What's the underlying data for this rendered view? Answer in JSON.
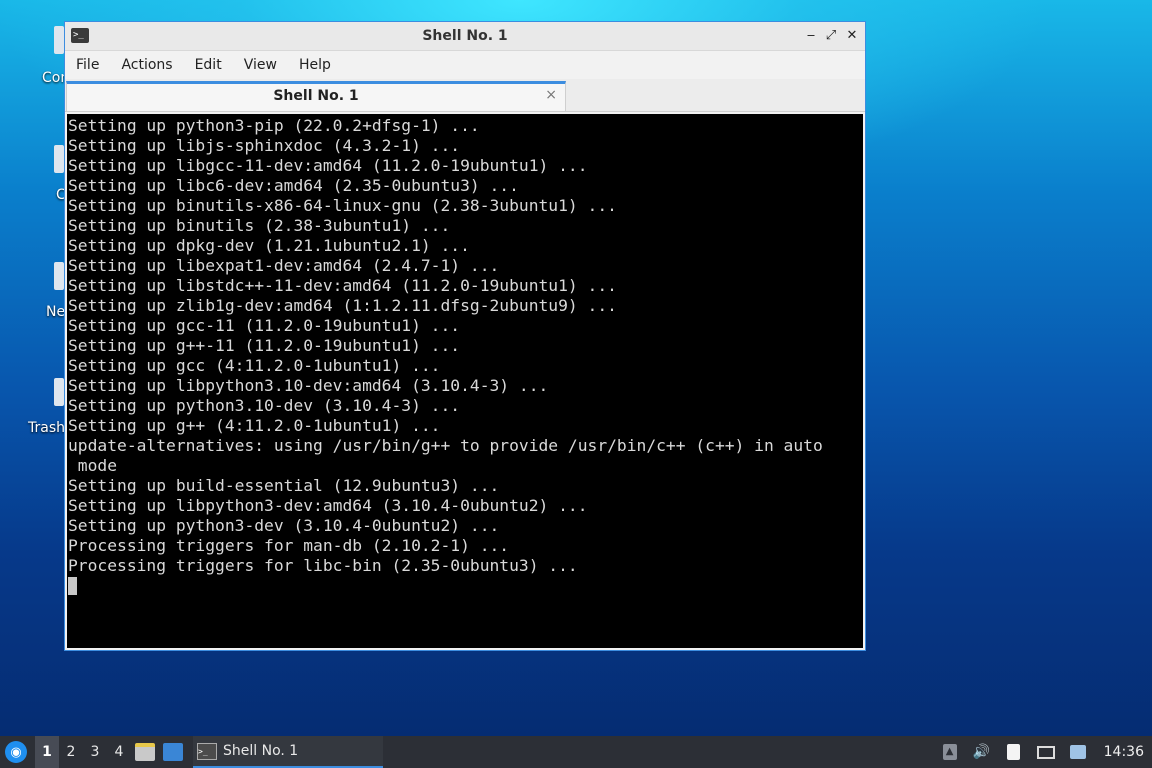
{
  "desktop": {
    "icons": [
      {
        "label": "Com"
      },
      {
        "label": "C"
      },
      {
        "label": "Ne"
      },
      {
        "label": "Trash"
      }
    ]
  },
  "window": {
    "title": "Shell No. 1",
    "controls": {
      "minimize": "‒",
      "maximize": "⤢",
      "close": "✕"
    },
    "menu": [
      "File",
      "Actions",
      "Edit",
      "View",
      "Help"
    ],
    "tab": {
      "label": "Shell No. 1",
      "close": "×"
    }
  },
  "terminal": {
    "lines": [
      "Setting up python3-pip (22.0.2+dfsg-1) ...",
      "Setting up libjs-sphinxdoc (4.3.2-1) ...",
      "Setting up libgcc-11-dev:amd64 (11.2.0-19ubuntu1) ...",
      "Setting up libc6-dev:amd64 (2.35-0ubuntu3) ...",
      "Setting up binutils-x86-64-linux-gnu (2.38-3ubuntu1) ...",
      "Setting up binutils (2.38-3ubuntu1) ...",
      "Setting up dpkg-dev (1.21.1ubuntu2.1) ...",
      "Setting up libexpat1-dev:amd64 (2.4.7-1) ...",
      "Setting up libstdc++-11-dev:amd64 (11.2.0-19ubuntu1) ...",
      "Setting up zlib1g-dev:amd64 (1:1.2.11.dfsg-2ubuntu9) ...",
      "Setting up gcc-11 (11.2.0-19ubuntu1) ...",
      "Setting up g++-11 (11.2.0-19ubuntu1) ...",
      "Setting up gcc (4:11.2.0-1ubuntu1) ...",
      "Setting up libpython3.10-dev:amd64 (3.10.4-3) ...",
      "Setting up python3.10-dev (3.10.4-3) ...",
      "Setting up g++ (4:11.2.0-1ubuntu1) ...",
      "update-alternatives: using /usr/bin/g++ to provide /usr/bin/c++ (c++) in auto",
      " mode",
      "Setting up build-essential (12.9ubuntu3) ...",
      "Setting up libpython3-dev:amd64 (3.10.4-0ubuntu2) ...",
      "Setting up python3-dev (3.10.4-0ubuntu2) ...",
      "Processing triggers for man-db (2.10.2-1) ...",
      "Processing triggers for libc-bin (2.35-0ubuntu3) ..."
    ]
  },
  "taskbar": {
    "workspaces": [
      "1",
      "2",
      "3",
      "4"
    ],
    "active_workspace": "1",
    "task_label": "Shell No. 1",
    "clock": "14:36",
    "colors": {
      "accent": "#3c8de0",
      "panel": "#2c2f36"
    }
  }
}
